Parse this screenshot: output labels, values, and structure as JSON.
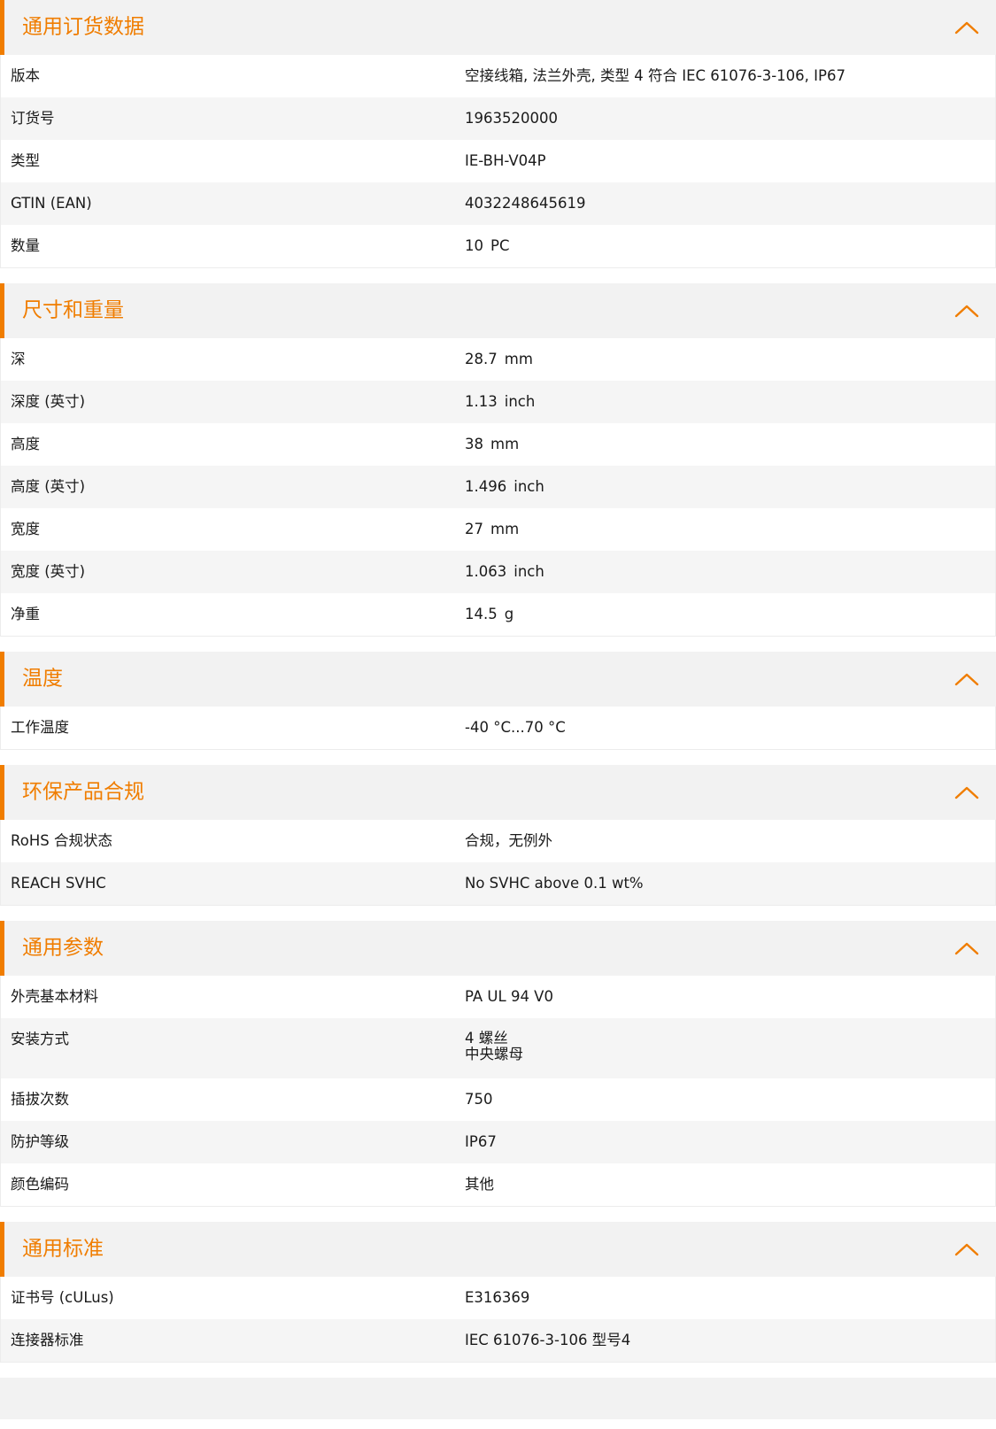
{
  "accent_color": "#f07d00",
  "collapse_icon": "chevron-up-icon",
  "sections": [
    {
      "title": "通用订货数据",
      "rows": [
        {
          "label": "版本",
          "value": "空接线箱, 法兰外壳, 类型 4 符合 IEC 61076-3-106, IP67"
        },
        {
          "label": "订货号",
          "value": "1963520000"
        },
        {
          "label": "类型",
          "value": "IE-BH-V04P"
        },
        {
          "label": "GTIN (EAN)",
          "value": "4032248645619"
        },
        {
          "label": "数量",
          "value": "10",
          "unit": "PC"
        }
      ]
    },
    {
      "title": "尺寸和重量",
      "rows": [
        {
          "label": "深",
          "value": "28.7",
          "unit": "mm"
        },
        {
          "label": "深度 (英寸)",
          "value": "1.13",
          "unit": "inch"
        },
        {
          "label": "高度",
          "value": "38",
          "unit": "mm"
        },
        {
          "label": "高度 (英寸)",
          "value": "1.496",
          "unit": "inch"
        },
        {
          "label": "宽度",
          "value": "27",
          "unit": "mm"
        },
        {
          "label": "宽度 (英寸)",
          "value": "1.063",
          "unit": "inch"
        },
        {
          "label": "净重",
          "value": "14.5",
          "unit": "g"
        }
      ]
    },
    {
      "title": "温度",
      "rows": [
        {
          "label": "工作温度",
          "value": "-40 °C...70 °C"
        }
      ]
    },
    {
      "title": "环保产品合规",
      "rows": [
        {
          "label": "RoHS 合规状态",
          "value": "合规，无例外"
        },
        {
          "label": "REACH SVHC",
          "value": "No SVHC above 0.1 wt%"
        }
      ]
    },
    {
      "title": "通用参数",
      "rows": [
        {
          "label": "外壳基本材料",
          "value": "PA UL 94 V0"
        },
        {
          "label": "安装方式",
          "lines": [
            "4 螺丝",
            "中央螺母"
          ]
        },
        {
          "label": "插拔次数",
          "value": "750"
        },
        {
          "label": "防护等级",
          "value": "IP67"
        },
        {
          "label": "颜色编码",
          "value": "其他"
        }
      ]
    },
    {
      "title": "通用标准",
      "rows": [
        {
          "label": "证书号 (cULus)",
          "value": "E316369"
        },
        {
          "label": "连接器标准",
          "value": "IEC 61076-3-106 型号4"
        }
      ]
    }
  ]
}
